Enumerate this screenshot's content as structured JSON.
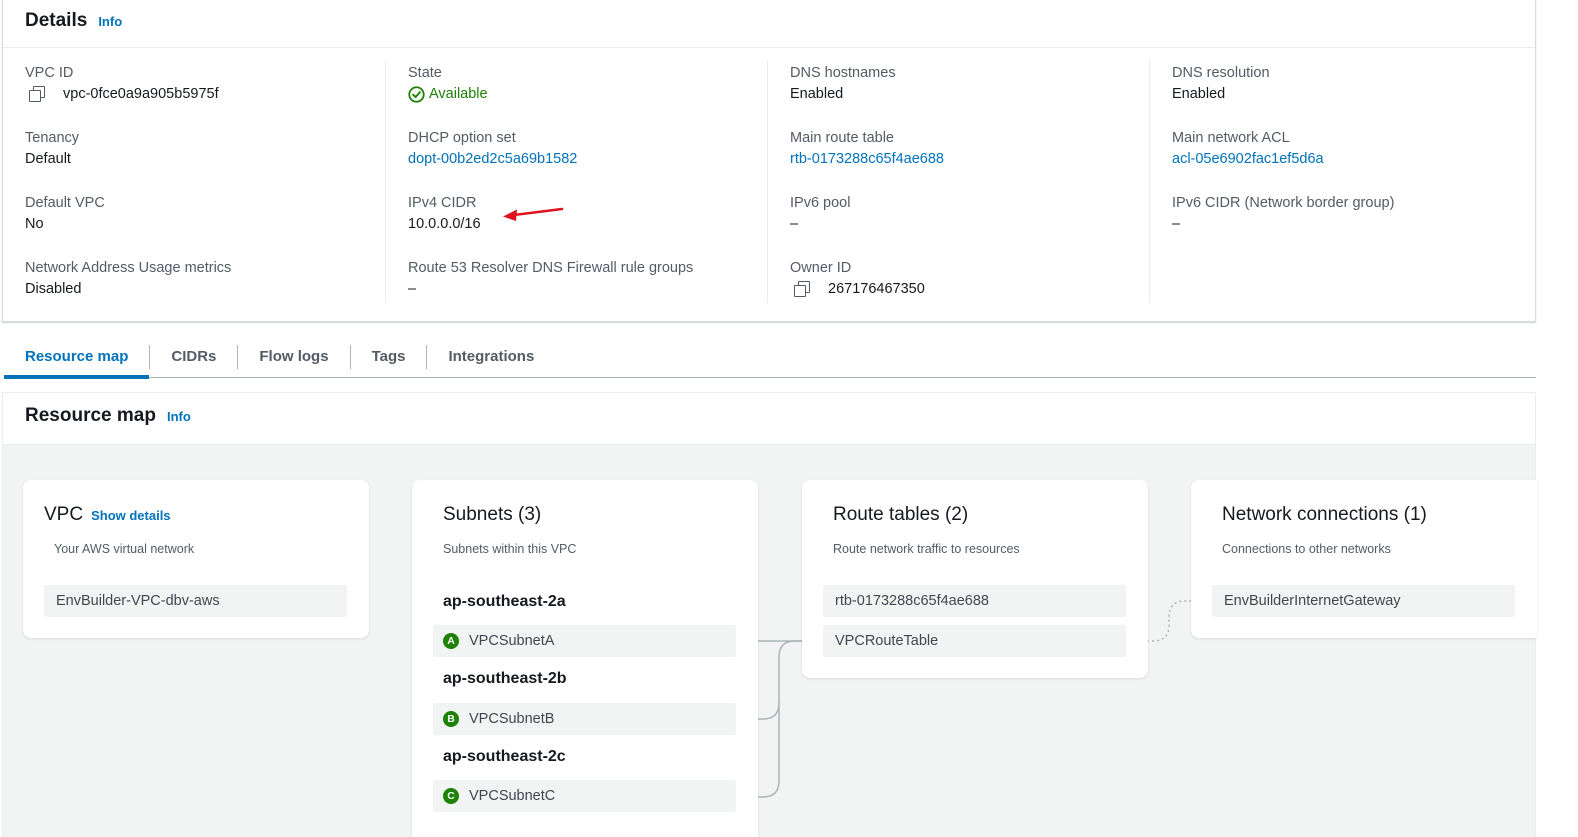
{
  "details": {
    "title": "Details",
    "info": "Info",
    "columns": [
      [
        {
          "label": "VPC ID",
          "value": "vpc-0fce0a9a905b5975f",
          "style": "copy"
        },
        {
          "label": "Tenancy",
          "value": "Default"
        },
        {
          "label": "Default VPC",
          "value": "No"
        },
        {
          "label": "Network Address Usage metrics",
          "value": "Disabled"
        }
      ],
      [
        {
          "label": "State",
          "value": "Available",
          "style": "status-ok"
        },
        {
          "label": "DHCP option set",
          "value": "dopt-00b2ed2c5a69b1582",
          "style": "link"
        },
        {
          "label": "IPv4 CIDR",
          "value": "10.0.0.0/16"
        },
        {
          "label": "Route 53 Resolver DNS Firewall rule groups",
          "value": "–"
        }
      ],
      [
        {
          "label": "DNS hostnames",
          "value": "Enabled"
        },
        {
          "label": "Main route table",
          "value": "rtb-0173288c65f4ae688",
          "style": "link"
        },
        {
          "label": "IPv6 pool",
          "value": "–"
        },
        {
          "label": "Owner ID",
          "value": "267176467350",
          "style": "copy"
        }
      ],
      [
        {
          "label": "DNS resolution",
          "value": "Enabled"
        },
        {
          "label": "Main network ACL",
          "value": "acl-05e6902fac1ef5d6a",
          "style": "link"
        },
        {
          "label": "IPv6 CIDR (Network border group)",
          "value": "–"
        }
      ]
    ]
  },
  "tabs": [
    "Resource map",
    "CIDRs",
    "Flow logs",
    "Tags",
    "Integrations"
  ],
  "active_tab": "Resource map",
  "resource_map": {
    "title": "Resource map",
    "info": "Info",
    "vpc": {
      "title": "VPC",
      "show_details": "Show details",
      "subtitle": "Your AWS virtual network",
      "name": "EnvBuilder-VPC-dbv-aws"
    },
    "subnets": {
      "title": "Subnets (3)",
      "subtitle": "Subnets within this VPC",
      "zones": [
        {
          "zone": "ap-southeast-2a",
          "badge": "A",
          "subnet": "VPCSubnetA"
        },
        {
          "zone": "ap-southeast-2b",
          "badge": "B",
          "subnet": "VPCSubnetB"
        },
        {
          "zone": "ap-southeast-2c",
          "badge": "C",
          "subnet": "VPCSubnetC"
        }
      ]
    },
    "route_tables": {
      "title": "Route tables (2)",
      "subtitle": "Route network traffic to resources",
      "items": [
        "rtb-0173288c65f4ae688",
        "VPCRouteTable"
      ]
    },
    "network_connections": {
      "title": "Network connections (1)",
      "subtitle": "Connections to other networks",
      "items": [
        "EnvBuilderInternetGateway"
      ]
    }
  },
  "colors": {
    "link": "#0073bb",
    "success": "#1d8102",
    "annotation_arrow": "#e0121f"
  }
}
